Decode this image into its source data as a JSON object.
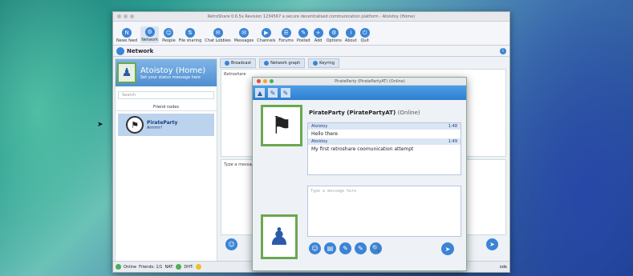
{
  "window": {
    "title": "RetroShare 0.6.5x Revision 1234567 a secure decentralised communication platform - Atoistoy (Home)"
  },
  "toolbar": [
    {
      "label": "News feed",
      "icon": "N"
    },
    {
      "label": "Network",
      "icon": "⚙",
      "active": true
    },
    {
      "label": "People",
      "icon": "☺"
    },
    {
      "label": "File sharing",
      "icon": "⇅"
    },
    {
      "label": "Chat Lobbies",
      "icon": "✉"
    },
    {
      "label": "Messages",
      "icon": "✉"
    },
    {
      "label": "Channels",
      "icon": "▶"
    },
    {
      "label": "Forums",
      "icon": "☰"
    },
    {
      "label": "Posted",
      "icon": "✎"
    },
    {
      "label": "Add",
      "icon": "+"
    },
    {
      "label": "Options",
      "icon": "⚙"
    },
    {
      "label": "About",
      "icon": "i"
    },
    {
      "label": "Quit",
      "icon": "⏻"
    }
  ],
  "nav": {
    "title": "Network",
    "info": "i"
  },
  "profile": {
    "name": "Atoistoy (Home)",
    "status": "Set your status message here"
  },
  "search": {
    "placeholder": "Search"
  },
  "friends": {
    "header": "Friend nodes",
    "items": [
      {
        "name": "PirateParty",
        "status": "Arrrrrrr!"
      }
    ]
  },
  "tabs": [
    {
      "label": "Broadcast"
    },
    {
      "label": "Network graph"
    },
    {
      "label": "Keyring"
    }
  ],
  "broadcast": {
    "label": "Retroshare",
    "input_placeholder": "Type a message"
  },
  "status": {
    "online": "Online",
    "friends": "Friends: 1/1",
    "nat": "NAT:",
    "dht": "DHT:",
    "right": "ode"
  },
  "chat": {
    "title": "PirateParty (PiratePartyAT) (Online)",
    "heading_name": "PirateParty (PiratePartyAT)",
    "heading_status": "(Online)",
    "messages": [
      {
        "author": "Atoistoy",
        "time": "1:48",
        "text": "Hello there"
      },
      {
        "author": "Atoistoy",
        "time": "1:49",
        "text": "My first retroshare coomunication attempt"
      }
    ],
    "input_placeholder": "Type a message here",
    "buttons": [
      "☺",
      "▤",
      "✎",
      "✎",
      "🔍"
    ],
    "send": "➤",
    "tools": [
      "▲",
      "✎",
      "✎"
    ]
  }
}
